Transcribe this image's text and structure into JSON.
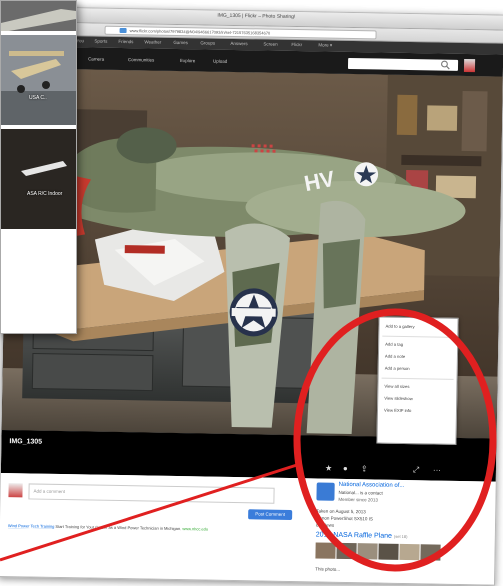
{
  "window": {
    "title": "IMG_1305 | Flickr – Photo Sharing!",
    "url_domain": "www.flickr.com",
    "url_path": "/photos/7979834@N04/9466617093/in/set-72157635168354670"
  },
  "top_nav": {
    "items": [
      "You",
      "Sports",
      "Friends",
      "Weather",
      "Games",
      "Groups",
      "Answers",
      "Screen",
      "Flickr",
      "More ▾"
    ]
  },
  "main_nav": {
    "items": [
      "Camera",
      "Communities",
      "Explore",
      "Upload"
    ]
  },
  "photo": {
    "title": "IMG_1305"
  },
  "menu": {
    "items": [
      "Add to a gallery",
      "Add a tag",
      "Add a note",
      "Add a person",
      "View all sizes",
      "View slideshow",
      "View EXIF info"
    ]
  },
  "owner": {
    "name": "National Association of...",
    "sub": "National... is a contact",
    "member": "Member since 2013"
  },
  "details": {
    "taken": "Taken on August 5, 2013",
    "camera": "Canon PowerShot SX510 IS",
    "views": "88 Views"
  },
  "album": {
    "title": "2014 NASA Raffle Plane",
    "count": "(set 18)"
  },
  "comment": {
    "placeholder": "Add a comment",
    "post_label": "Post Comment"
  },
  "ad": {
    "link": "Wind Power Tech Training",
    "text": "Start Training for Your Career as a Wind Power Technician in Michigan.",
    "domain": "www.nhcc.edu"
  },
  "thumbs": {
    "cap1": "USA C..",
    "cap2": "ASA R/C Indoor"
  },
  "footer_hint": "This photo..."
}
